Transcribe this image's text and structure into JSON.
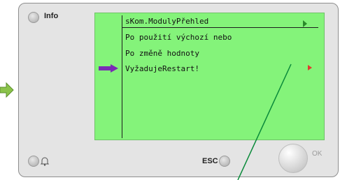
{
  "panel": {
    "info_label": "Info",
    "esc_label": "ESC",
    "ok_label": "OK"
  },
  "lcd": {
    "header": "sKom.ModulyPřehled",
    "lines": [
      "Po použití výchozí nebo",
      "Po změně hodnoty",
      "VyžadujeRestart!"
    ]
  },
  "colors": {
    "lcd_background": "#84f37a",
    "pointer_arrow": "#7a2bb5",
    "side_arrow": "#8bc34a",
    "marker": "#e23b2f",
    "annotation_line": "#0a8a3a"
  }
}
